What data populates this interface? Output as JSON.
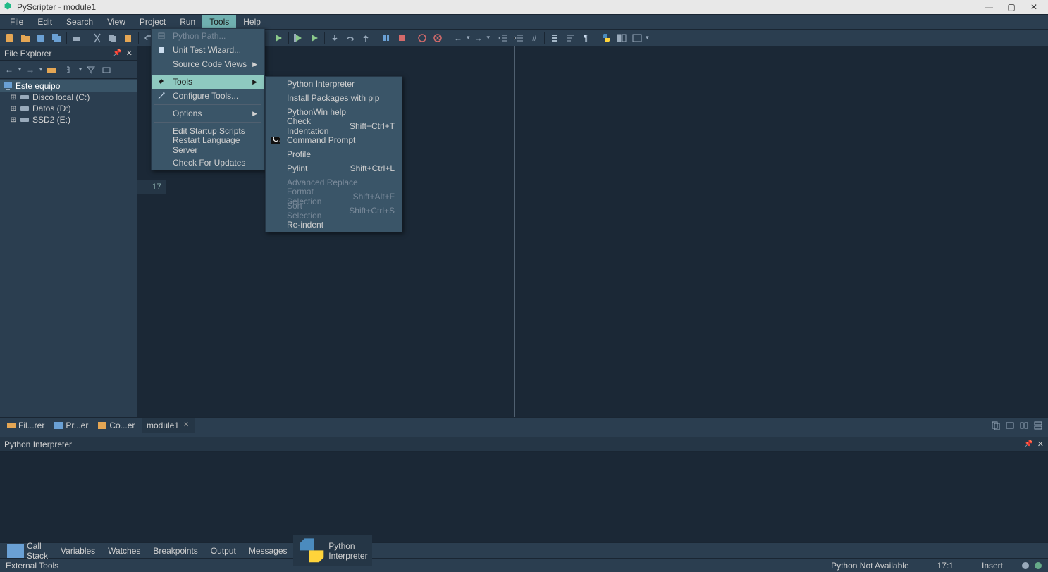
{
  "title": "PyScripter - module1",
  "menubar": [
    "File",
    "Edit",
    "Search",
    "View",
    "Project",
    "Run",
    "Tools",
    "Help"
  ],
  "active_menu_index": 6,
  "tools_menu": [
    {
      "label": "Python Path...",
      "disabled": true,
      "icon": "path"
    },
    {
      "label": "Unit Test Wizard...",
      "icon": "wizard"
    },
    {
      "label": "Source Code Views",
      "submenu": true
    },
    {
      "sep": true
    },
    {
      "label": "Tools",
      "submenu": true,
      "hover": true,
      "icon": "tools"
    },
    {
      "label": "Configure Tools...",
      "icon": "config"
    },
    {
      "sep": true
    },
    {
      "label": "Options",
      "submenu": true
    },
    {
      "sep": true
    },
    {
      "label": "Edit Startup Scripts"
    },
    {
      "label": "Restart Language Server"
    },
    {
      "sep": true
    },
    {
      "label": "Check For Updates"
    }
  ],
  "tools_submenu": [
    {
      "label": "Python Interpreter"
    },
    {
      "label": "Install Packages with pip"
    },
    {
      "label": "PythonWin help"
    },
    {
      "label": "Check Indentation",
      "shortcut": "Shift+Ctrl+T"
    },
    {
      "label": "Command Prompt",
      "icon": "cmd"
    },
    {
      "label": "Profile"
    },
    {
      "label": "Pylint",
      "shortcut": "Shift+Ctrl+L"
    },
    {
      "label": "Advanced Replace",
      "disabled": true
    },
    {
      "label": "Format Selection",
      "shortcut": "Shift+Alt+F",
      "disabled": true
    },
    {
      "label": "Sort Selection",
      "shortcut": "Shift+Ctrl+S",
      "disabled": true
    },
    {
      "label": "Re-indent"
    }
  ],
  "file_explorer": {
    "title": "File Explorer",
    "root": "Este equipo",
    "children": [
      {
        "label": "Disco local (C:)"
      },
      {
        "label": "Datos (D:)"
      },
      {
        "label": "SSD2 (E:)"
      }
    ]
  },
  "sidebar_tabs": [
    {
      "label": "Fil...rer"
    },
    {
      "label": "Pr...er"
    },
    {
      "label": "Co...er"
    }
  ],
  "editor_tab": "module1",
  "editor_visible_tab_text": "e1",
  "gutter_last_line": "17",
  "interpreter_title": "Python Interpreter",
  "dock_tabs": [
    {
      "label": "Call Stack"
    },
    {
      "label": "Variables"
    },
    {
      "label": "Watches"
    },
    {
      "label": "Breakpoints"
    },
    {
      "label": "Output"
    },
    {
      "label": "Messages"
    },
    {
      "label": "Python Interpreter",
      "active": true,
      "python": true
    }
  ],
  "status": {
    "left": "External Tools",
    "python": "Python Not Available",
    "pos": "17:1",
    "mode": "Insert"
  }
}
